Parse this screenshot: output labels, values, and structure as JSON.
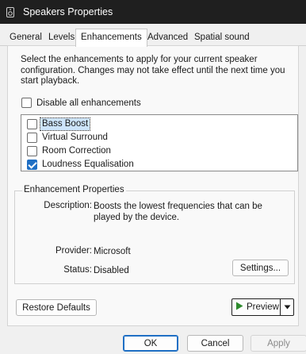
{
  "window": {
    "title": "Speakers Properties",
    "icon": "speaker-icon"
  },
  "tabs": [
    {
      "label": "General"
    },
    {
      "label": "Levels"
    },
    {
      "label": "Enhancements",
      "active": true
    },
    {
      "label": "Advanced"
    },
    {
      "label": "Spatial sound"
    }
  ],
  "enhancements": {
    "description": "Select the enhancements to apply for your current speaker configuration. Changes may not take effect until the next time you start playback.",
    "disable_all_label": "Disable all enhancements",
    "disable_all_checked": false,
    "items": [
      {
        "label": "Bass Boost",
        "checked": false,
        "selected": true
      },
      {
        "label": "Virtual Surround",
        "checked": false
      },
      {
        "label": "Room Correction",
        "checked": false
      },
      {
        "label": "Loudness Equalisation",
        "checked": true
      }
    ]
  },
  "properties": {
    "title": "Enhancement Properties",
    "description_label": "Description:",
    "description_value": "Boosts the lowest frequencies that can be played by the device.",
    "provider_label": "Provider:",
    "provider_value": "Microsoft",
    "status_label": "Status:",
    "status_value": "Disabled",
    "settings_button": "Settings..."
  },
  "buttons": {
    "restore_defaults": "Restore Defaults",
    "preview": "Preview",
    "ok": "OK",
    "cancel": "Cancel",
    "apply": "Apply"
  },
  "colors": {
    "accent": "#1f6fc4",
    "titlebar": "#1f1f1f",
    "preview_icon": "#2e8b2e"
  }
}
